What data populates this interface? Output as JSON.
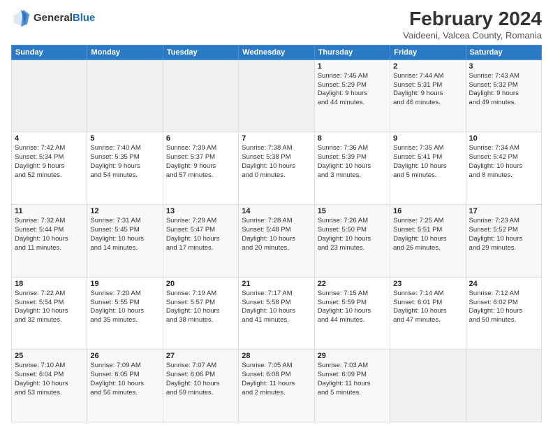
{
  "header": {
    "logo_general": "General",
    "logo_blue": "Blue",
    "month_year": "February 2024",
    "location": "Vaideeni, Valcea County, Romania"
  },
  "weekdays": [
    "Sunday",
    "Monday",
    "Tuesday",
    "Wednesday",
    "Thursday",
    "Friday",
    "Saturday"
  ],
  "weeks": [
    [
      {
        "day": "",
        "info": ""
      },
      {
        "day": "",
        "info": ""
      },
      {
        "day": "",
        "info": ""
      },
      {
        "day": "",
        "info": ""
      },
      {
        "day": "1",
        "info": "Sunrise: 7:45 AM\nSunset: 5:29 PM\nDaylight: 9 hours\nand 44 minutes."
      },
      {
        "day": "2",
        "info": "Sunrise: 7:44 AM\nSunset: 5:31 PM\nDaylight: 9 hours\nand 46 minutes."
      },
      {
        "day": "3",
        "info": "Sunrise: 7:43 AM\nSunset: 5:32 PM\nDaylight: 9 hours\nand 49 minutes."
      }
    ],
    [
      {
        "day": "4",
        "info": "Sunrise: 7:42 AM\nSunset: 5:34 PM\nDaylight: 9 hours\nand 52 minutes."
      },
      {
        "day": "5",
        "info": "Sunrise: 7:40 AM\nSunset: 5:35 PM\nDaylight: 9 hours\nand 54 minutes."
      },
      {
        "day": "6",
        "info": "Sunrise: 7:39 AM\nSunset: 5:37 PM\nDaylight: 9 hours\nand 57 minutes."
      },
      {
        "day": "7",
        "info": "Sunrise: 7:38 AM\nSunset: 5:38 PM\nDaylight: 10 hours\nand 0 minutes."
      },
      {
        "day": "8",
        "info": "Sunrise: 7:36 AM\nSunset: 5:39 PM\nDaylight: 10 hours\nand 3 minutes."
      },
      {
        "day": "9",
        "info": "Sunrise: 7:35 AM\nSunset: 5:41 PM\nDaylight: 10 hours\nand 5 minutes."
      },
      {
        "day": "10",
        "info": "Sunrise: 7:34 AM\nSunset: 5:42 PM\nDaylight: 10 hours\nand 8 minutes."
      }
    ],
    [
      {
        "day": "11",
        "info": "Sunrise: 7:32 AM\nSunset: 5:44 PM\nDaylight: 10 hours\nand 11 minutes."
      },
      {
        "day": "12",
        "info": "Sunrise: 7:31 AM\nSunset: 5:45 PM\nDaylight: 10 hours\nand 14 minutes."
      },
      {
        "day": "13",
        "info": "Sunrise: 7:29 AM\nSunset: 5:47 PM\nDaylight: 10 hours\nand 17 minutes."
      },
      {
        "day": "14",
        "info": "Sunrise: 7:28 AM\nSunset: 5:48 PM\nDaylight: 10 hours\nand 20 minutes."
      },
      {
        "day": "15",
        "info": "Sunrise: 7:26 AM\nSunset: 5:50 PM\nDaylight: 10 hours\nand 23 minutes."
      },
      {
        "day": "16",
        "info": "Sunrise: 7:25 AM\nSunset: 5:51 PM\nDaylight: 10 hours\nand 26 minutes."
      },
      {
        "day": "17",
        "info": "Sunrise: 7:23 AM\nSunset: 5:52 PM\nDaylight: 10 hours\nand 29 minutes."
      }
    ],
    [
      {
        "day": "18",
        "info": "Sunrise: 7:22 AM\nSunset: 5:54 PM\nDaylight: 10 hours\nand 32 minutes."
      },
      {
        "day": "19",
        "info": "Sunrise: 7:20 AM\nSunset: 5:55 PM\nDaylight: 10 hours\nand 35 minutes."
      },
      {
        "day": "20",
        "info": "Sunrise: 7:19 AM\nSunset: 5:57 PM\nDaylight: 10 hours\nand 38 minutes."
      },
      {
        "day": "21",
        "info": "Sunrise: 7:17 AM\nSunset: 5:58 PM\nDaylight: 10 hours\nand 41 minutes."
      },
      {
        "day": "22",
        "info": "Sunrise: 7:15 AM\nSunset: 5:59 PM\nDaylight: 10 hours\nand 44 minutes."
      },
      {
        "day": "23",
        "info": "Sunrise: 7:14 AM\nSunset: 6:01 PM\nDaylight: 10 hours\nand 47 minutes."
      },
      {
        "day": "24",
        "info": "Sunrise: 7:12 AM\nSunset: 6:02 PM\nDaylight: 10 hours\nand 50 minutes."
      }
    ],
    [
      {
        "day": "25",
        "info": "Sunrise: 7:10 AM\nSunset: 6:04 PM\nDaylight: 10 hours\nand 53 minutes."
      },
      {
        "day": "26",
        "info": "Sunrise: 7:09 AM\nSunset: 6:05 PM\nDaylight: 10 hours\nand 56 minutes."
      },
      {
        "day": "27",
        "info": "Sunrise: 7:07 AM\nSunset: 6:06 PM\nDaylight: 10 hours\nand 59 minutes."
      },
      {
        "day": "28",
        "info": "Sunrise: 7:05 AM\nSunset: 6:08 PM\nDaylight: 11 hours\nand 2 minutes."
      },
      {
        "day": "29",
        "info": "Sunrise: 7:03 AM\nSunset: 6:09 PM\nDaylight: 11 hours\nand 5 minutes."
      },
      {
        "day": "",
        "info": ""
      },
      {
        "day": "",
        "info": ""
      }
    ]
  ]
}
